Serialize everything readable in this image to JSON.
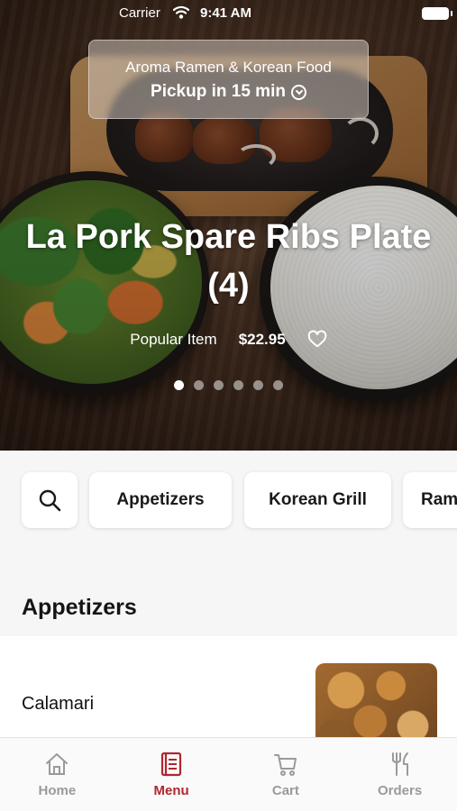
{
  "status_bar": {
    "carrier": "Carrier",
    "time": "9:41 AM"
  },
  "restaurant": {
    "name": "Aroma Ramen & Korean Food",
    "pickup": "Pickup in 15 min"
  },
  "featured_item": {
    "name": "La Pork Spare Ribs Plate (4)",
    "tag": "Popular Item",
    "price": "$22.95",
    "carousel_pages": 6,
    "carousel_active_index": 0
  },
  "categories": [
    "Appetizers",
    "Korean Grill",
    "Ramen"
  ],
  "section": {
    "title": "Appetizers"
  },
  "menu_items": [
    {
      "name": "Calamari"
    }
  ],
  "tabs": [
    {
      "label": "Home",
      "icon": "home-icon",
      "active": false
    },
    {
      "label": "Menu",
      "icon": "menu-book-icon",
      "active": true
    },
    {
      "label": "Cart",
      "icon": "cart-icon",
      "active": false
    },
    {
      "label": "Orders",
      "icon": "fork-knife-icon",
      "active": false
    }
  ],
  "colors": {
    "accent": "#b1262f",
    "tab_inactive": "#9a9a9a",
    "background": "#f6f6f6"
  }
}
